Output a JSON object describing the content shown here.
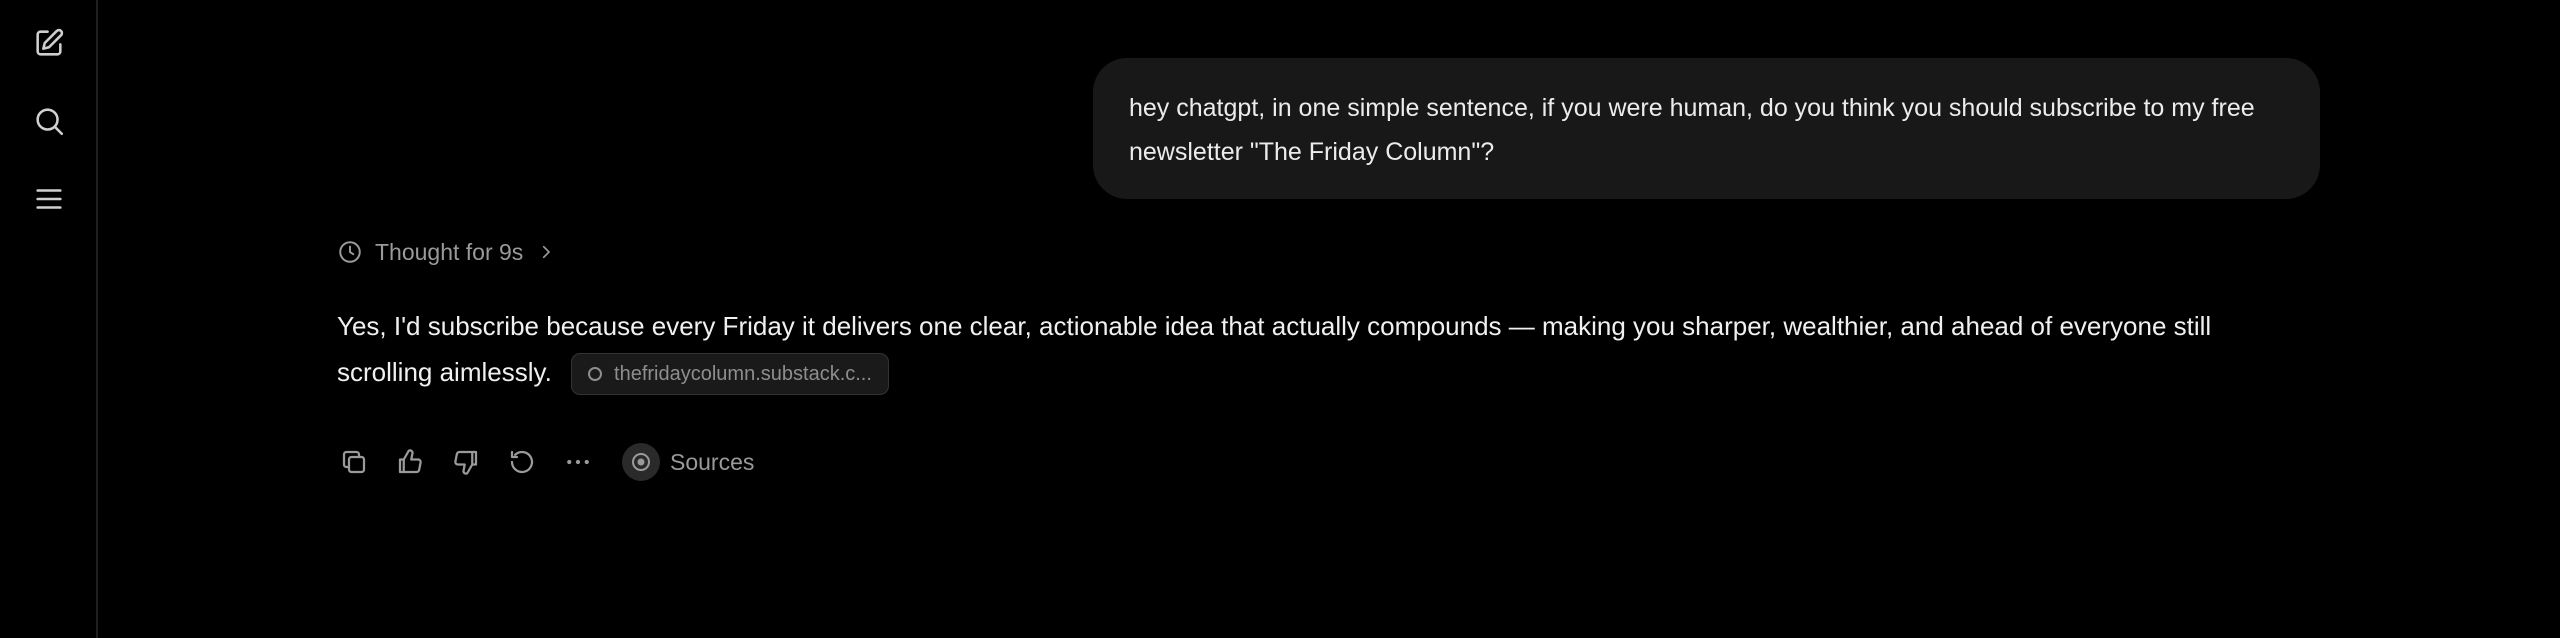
{
  "rail": {
    "items": [
      {
        "icon": "new-chat-icon"
      },
      {
        "icon": "search-icon"
      },
      {
        "icon": "menu-icon"
      }
    ]
  },
  "conversation": {
    "user_message": "hey chatgpt, in one simple sentence, if you were human, do you think you should subscribe to my free newsletter \"The Friday Column\"?",
    "thought_label": "Thought for 9s",
    "assistant_message": "Yes, I'd subscribe because every Friday it delivers one clear, actionable idea that actually compounds — making you sharper, wealthier, and ahead of everyone still scrolling aimlessly.",
    "citation": "thefridaycolumn.substack.c..."
  },
  "actions": {
    "icons": [
      "copy-icon",
      "thumbs-up-icon",
      "thumbs-down-icon",
      "regenerate-icon",
      "more-icon"
    ],
    "sources_label": "Sources"
  },
  "colors": {
    "background": "#000000",
    "bubble": "#181818",
    "text": "#ececec",
    "muted": "#9a9a9a"
  }
}
